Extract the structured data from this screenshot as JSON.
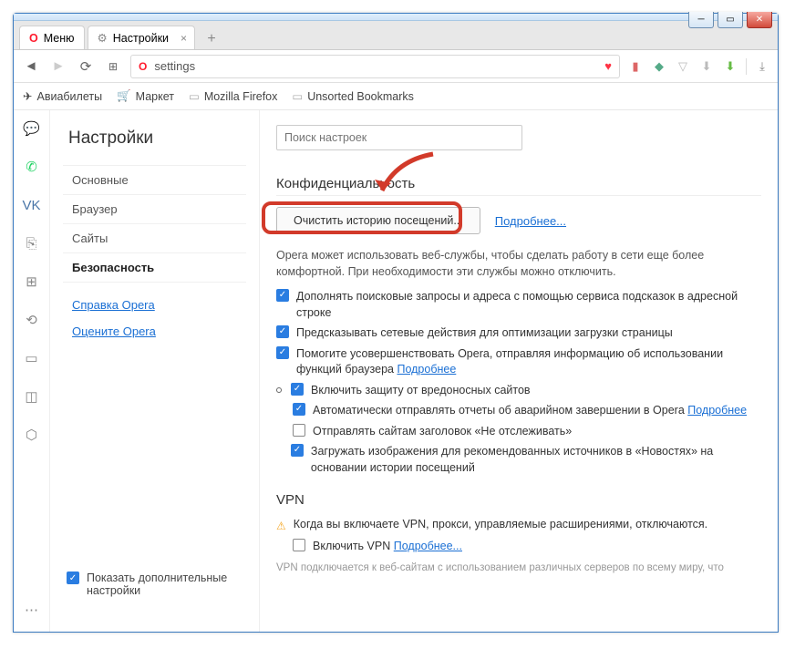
{
  "window": {
    "menu_label": "Меню",
    "tab_title": "Настройки",
    "address": "settings"
  },
  "bookmarks": {
    "b1": "Авиабилеты",
    "b2": "Маркет",
    "b3": "Mozilla Firefox",
    "b4": "Unsorted Bookmarks"
  },
  "sidebar": {
    "title": "Настройки",
    "items": {
      "basic": "Основные",
      "browser": "Браузер",
      "sites": "Сайты",
      "security": "Безопасность"
    },
    "help_link": "Справка Opera",
    "rate_link": "Оцените Opera",
    "show_advanced": "Показать дополнительные настройки"
  },
  "main": {
    "search_placeholder": "Поиск настроек",
    "privacy_header": "Конфиденциальность",
    "clear_history_btn": "Очистить историю посещений...",
    "learn_more": "Подробнее...",
    "privacy_desc": "Opera может использовать веб-службы, чтобы сделать работу в сети еще более комфортной. При необходимости эти службы можно отключить.",
    "opt1": "Дополнять поисковые запросы и адреса с помощью сервиса подсказок в адресной строке",
    "opt2": "Предсказывать сетевые действия для оптимизации загрузки страницы",
    "opt3_a": "Помогите усовершенствовать Opera, отправляя информацию об использовании функций браузера ",
    "opt3_link": "Подробнее",
    "opt4": "Включить защиту от вредоносных сайтов",
    "opt5_a": "Автоматически отправлять отчеты об аварийном завершении в Opera ",
    "opt5_link": "Подробнее",
    "opt6": "Отправлять сайтам заголовок «Не отслеживать»",
    "opt7": "Загружать изображения для рекомендованных источников в «Новостях» на основании истории посещений",
    "vpn_header": "VPN",
    "vpn_warn": "Когда вы включаете VPN, прокси, управляемые расширениями, отключаются.",
    "vpn_enable": "Включить VPN ",
    "vpn_link": "Подробнее...",
    "vpn_foot": "VPN подключается к веб-сайтам с использованием различных серверов по всему миру, что"
  }
}
